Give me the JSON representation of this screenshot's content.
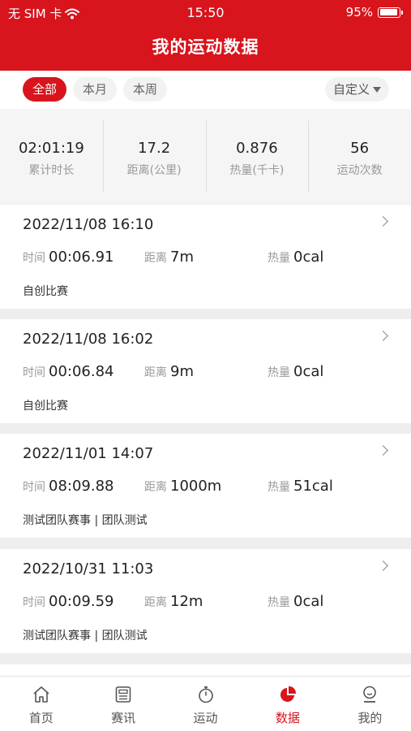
{
  "status": {
    "carrier": "无 SIM 卡",
    "time": "15:50",
    "battery": "95%"
  },
  "header": {
    "title": "我的运动数据"
  },
  "filters": {
    "all": "全部",
    "month": "本月",
    "week": "本周",
    "custom": "自定义",
    "active": "all"
  },
  "summary": [
    {
      "value": "02:01:19",
      "label": "累计时长"
    },
    {
      "value": "17.2",
      "label": "距离(公里)"
    },
    {
      "value": "0.876",
      "label": "热量(千卡)"
    },
    {
      "value": "56",
      "label": "运动次数"
    }
  ],
  "labels": {
    "time": "时间",
    "distance": "距离",
    "calories": "热量"
  },
  "records": [
    {
      "datetime": "2022/11/08 16:10",
      "time": "00:06.91",
      "distance": "7m",
      "calories": "0cal",
      "desc": "自创比赛"
    },
    {
      "datetime": "2022/11/08 16:02",
      "time": "00:06.84",
      "distance": "9m",
      "calories": "0cal",
      "desc": "自创比赛"
    },
    {
      "datetime": "2022/11/01 14:07",
      "time": "08:09.88",
      "distance": "1000m",
      "calories": "51cal",
      "desc": "测试团队赛事 | 团队测试"
    },
    {
      "datetime": "2022/10/31 11:03",
      "time": "00:09.59",
      "distance": "12m",
      "calories": "0cal",
      "desc": "测试团队赛事 | 团队测试"
    }
  ],
  "tabs": [
    {
      "label": "首页",
      "icon": "home-icon"
    },
    {
      "label": "赛讯",
      "icon": "news-icon"
    },
    {
      "label": "运动",
      "icon": "stopwatch-icon"
    },
    {
      "label": "数据",
      "icon": "pie-chart-icon",
      "active": true
    },
    {
      "label": "我的",
      "icon": "profile-icon"
    }
  ],
  "colors": {
    "brand": "#d8141c",
    "background": "#eeeeee",
    "summary_bg": "#f5f5f5"
  }
}
